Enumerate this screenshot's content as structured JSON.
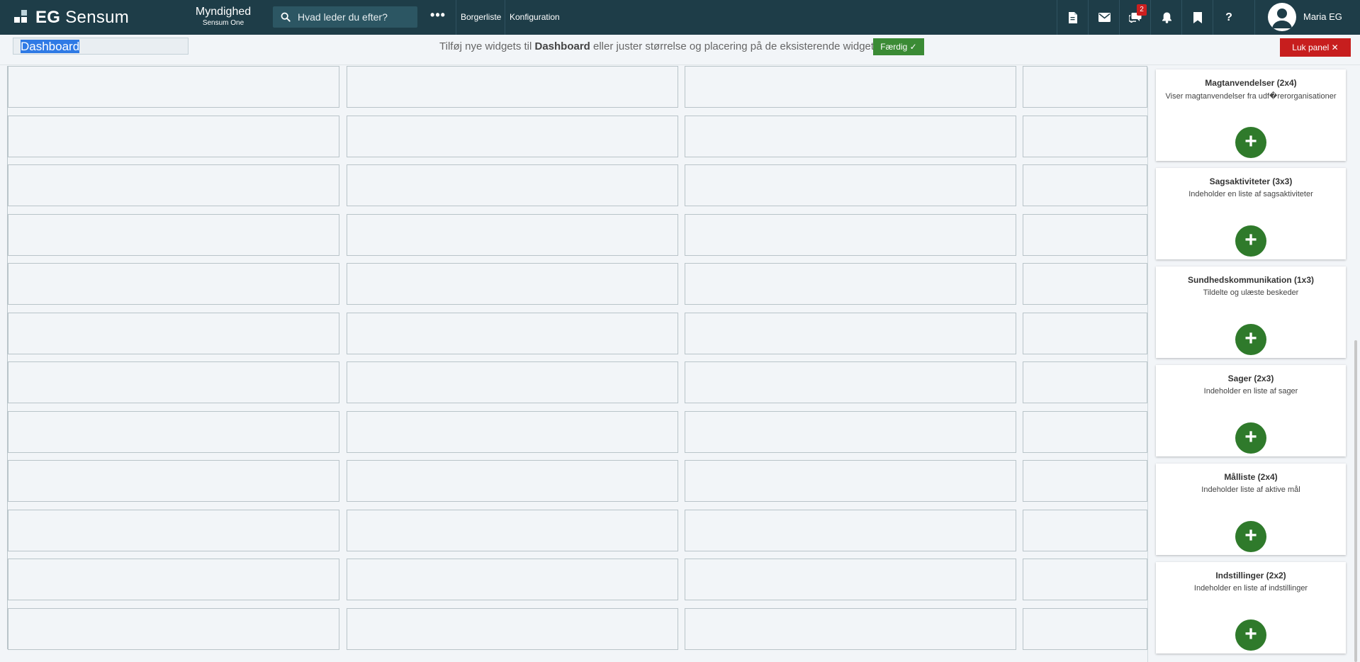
{
  "header": {
    "logo_prefix": "EG",
    "logo_name": "Sensum",
    "org_title": "Myndighed",
    "org_subtitle": "Sensum One",
    "search_placeholder": "Hvad leder du efter?",
    "more_label": "•••",
    "nav": [
      "Borgerliste",
      "Konfiguration"
    ],
    "icons": [
      "document-icon",
      "mail-icon",
      "chat-icon",
      "bell-icon",
      "bookmark-icon",
      "help-icon"
    ],
    "chat_badge": "2",
    "user_name": "Maria EG"
  },
  "editbar": {
    "dashboard_name": "Dashboard",
    "hint_before": "Tilføj nye widgets til ",
    "hint_bold": "Dashboard",
    "hint_after": " eller juster størrelse og placering på de eksisterende widgets",
    "done_label": "Færdig ✓",
    "close_label": "Luk panel ✕"
  },
  "widgets": [
    {
      "title": "Magtanvendelser (2x4)",
      "desc": "Viser magtanvendelser fra udf�rerorganisationer"
    },
    {
      "title": "Sagsaktiviteter (3x3)",
      "desc": "Indeholder en liste af sagsaktiviteter"
    },
    {
      "title": "Sundhedskommunikation (1x3)",
      "desc": "Tildelte og ulæste beskeder"
    },
    {
      "title": "Sager (2x3)",
      "desc": "Indeholder en liste af sager"
    },
    {
      "title": "Målliste (2x4)",
      "desc": "Indeholder liste af aktive mål"
    },
    {
      "title": "Indstillinger (2x2)",
      "desc": "Indeholder en liste af indstillinger"
    }
  ],
  "colors": {
    "topbar": "#1e3d48",
    "accent_green": "#3b8b35",
    "close_red": "#c71e1e",
    "badge_red": "#cc1f1f"
  }
}
